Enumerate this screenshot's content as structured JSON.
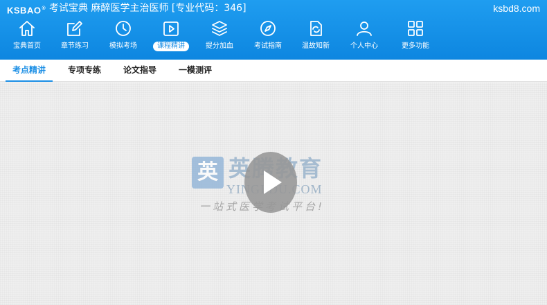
{
  "header": {
    "logo": "KSBAO",
    "logo_mark": "®",
    "title": "考试宝典 麻醉医学主治医师 [专业代码：346]",
    "site": "ksbd8.com"
  },
  "nav": {
    "items": [
      {
        "label": "宝典首页",
        "icon": "home-icon",
        "active": false
      },
      {
        "label": "章节练习",
        "icon": "edit-icon",
        "active": false
      },
      {
        "label": "模拟考场",
        "icon": "clock-icon",
        "active": false
      },
      {
        "label": "课程精讲",
        "icon": "video-play-icon",
        "active": true
      },
      {
        "label": "提分加血",
        "icon": "layers-icon",
        "active": false
      },
      {
        "label": "考试指南",
        "icon": "compass-icon",
        "active": false
      },
      {
        "label": "温故知新",
        "icon": "refresh-doc-icon",
        "active": false
      },
      {
        "label": "个人中心",
        "icon": "user-icon",
        "active": false
      },
      {
        "label": "更多功能",
        "icon": "grid-icon",
        "active": false
      }
    ]
  },
  "subtabs": [
    {
      "label": "考点精讲",
      "active": true
    },
    {
      "label": "专项专练",
      "active": false
    },
    {
      "label": "论文指导",
      "active": false
    },
    {
      "label": "一模测评",
      "active": false
    }
  ],
  "video": {
    "watermark_badge": "英",
    "watermark_cn": "英腾教育",
    "watermark_en": "YINGEDU.COM",
    "watermark_slogan": "一站式医学考试平台!"
  },
  "colors": {
    "header_blue": "#1a8ee5",
    "active_tab": "#1a8ee5"
  }
}
